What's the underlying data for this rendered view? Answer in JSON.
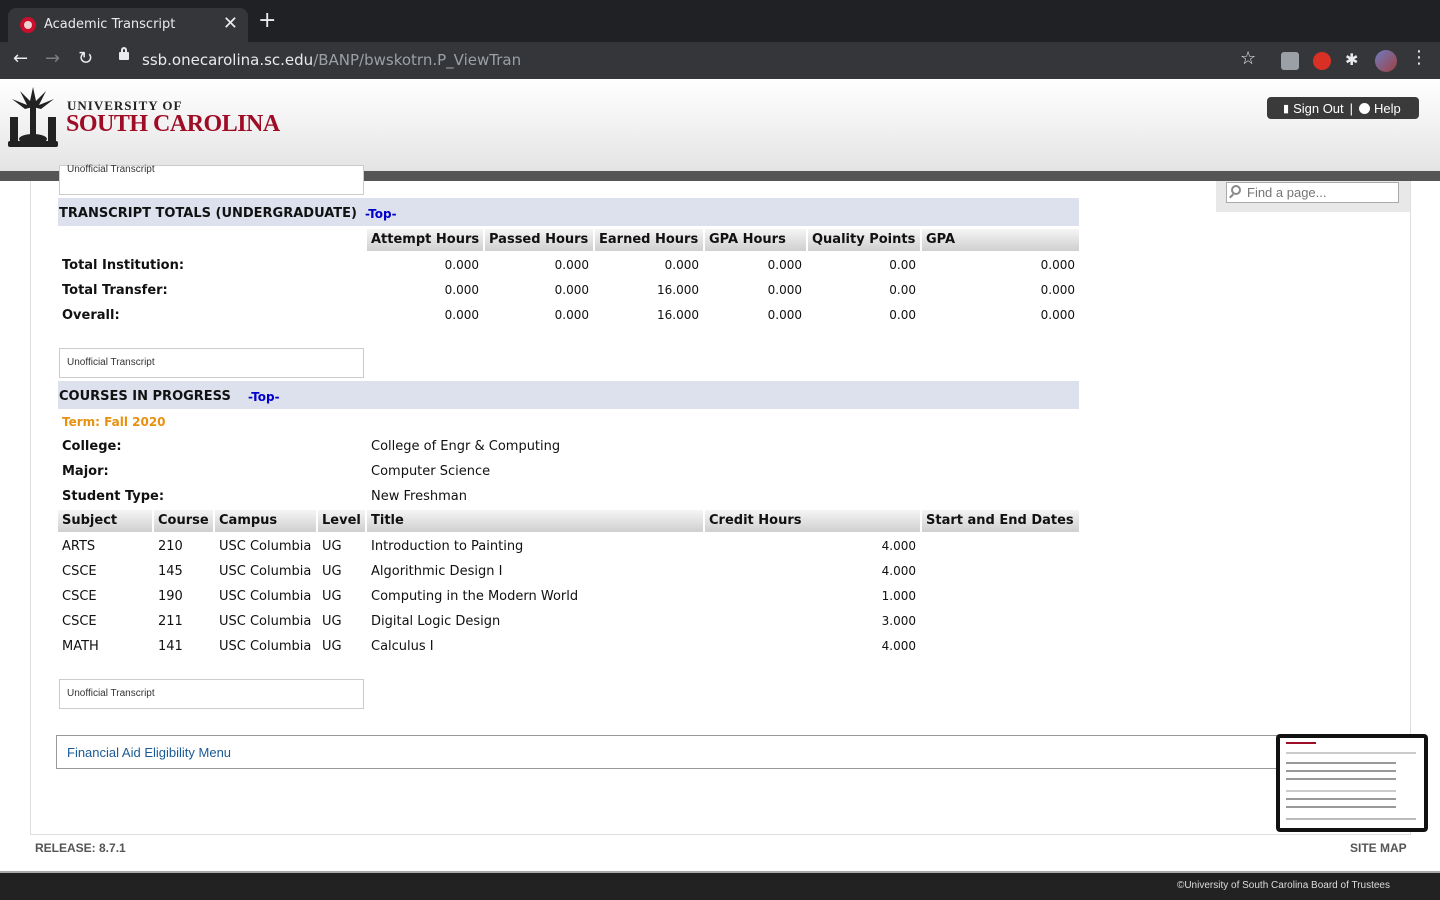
{
  "browser": {
    "tab_title": "Academic Transcript",
    "tab_close": "✕",
    "new_tab": "+",
    "back": "←",
    "forward": "→",
    "reload": "↻",
    "url_host": "ssb.onecarolina.sc.edu",
    "url_path": "/BANP/bwskotrn.P_ViewTran",
    "bookmark": "☆",
    "extensions_icon": "✱",
    "menu": "⋮"
  },
  "header": {
    "logo_line1": "UNIVERSITY OF",
    "logo_line2": "SOUTH CAROLINA",
    "sign_out": "Sign Out",
    "help": "Help",
    "separator": "|"
  },
  "search": {
    "placeholder": "Find a page..."
  },
  "unofficial_label": "Unofficial Transcript",
  "totals": {
    "title": "TRANSCRIPT TOTALS (UNDERGRADUATE)",
    "top_link": "-Top-",
    "headers": [
      "Attempt Hours",
      "Passed Hours",
      "Earned Hours",
      "GPA Hours",
      "Quality Points",
      "GPA"
    ],
    "rows": [
      {
        "label": "Total Institution:",
        "values": [
          "0.000",
          "0.000",
          "0.000",
          "0.000",
          "0.00",
          "0.000"
        ]
      },
      {
        "label": "Total Transfer:",
        "values": [
          "0.000",
          "0.000",
          "16.000",
          "0.000",
          "0.00",
          "0.000"
        ]
      },
      {
        "label": "Overall:",
        "values": [
          "0.000",
          "0.000",
          "16.000",
          "0.000",
          "0.00",
          "0.000"
        ]
      }
    ]
  },
  "in_progress": {
    "title": "COURSES IN PROGRESS",
    "top_link": "-Top-",
    "term": "Term: Fall 2020",
    "info": [
      {
        "label": "College:",
        "value": "College of Engr & Computing"
      },
      {
        "label": "Major:",
        "value": "Computer Science"
      },
      {
        "label": "Student Type:",
        "value": "New Freshman"
      }
    ],
    "headers": [
      "Subject",
      "Course",
      "Campus",
      "Level",
      "Title",
      "Credit Hours",
      "Start and End Dates"
    ],
    "courses": [
      {
        "subject": "ARTS",
        "course": "210",
        "campus": "USC Columbia",
        "level": "UG",
        "title": "Introduction to Painting",
        "credits": "4.000"
      },
      {
        "subject": "CSCE",
        "course": "145",
        "campus": "USC Columbia",
        "level": "UG",
        "title": "Algorithmic Design I",
        "credits": "4.000"
      },
      {
        "subject": "CSCE",
        "course": "190",
        "campus": "USC Columbia",
        "level": "UG",
        "title": "Computing in the Modern World",
        "credits": "1.000"
      },
      {
        "subject": "CSCE",
        "course": "211",
        "campus": "USC Columbia",
        "level": "UG",
        "title": "Digital Logic Design",
        "credits": "3.000"
      },
      {
        "subject": "MATH",
        "course": "141",
        "campus": "USC Columbia",
        "level": "UG",
        "title": "Calculus I",
        "credits": "4.000"
      }
    ]
  },
  "financial_aid_link": "Financial Aid Eligibility Menu",
  "footer": {
    "release": "RELEASE: 8.7.1",
    "site_map": "SITE MAP",
    "copyright": "©University of South Carolina Board of Trustees"
  }
}
